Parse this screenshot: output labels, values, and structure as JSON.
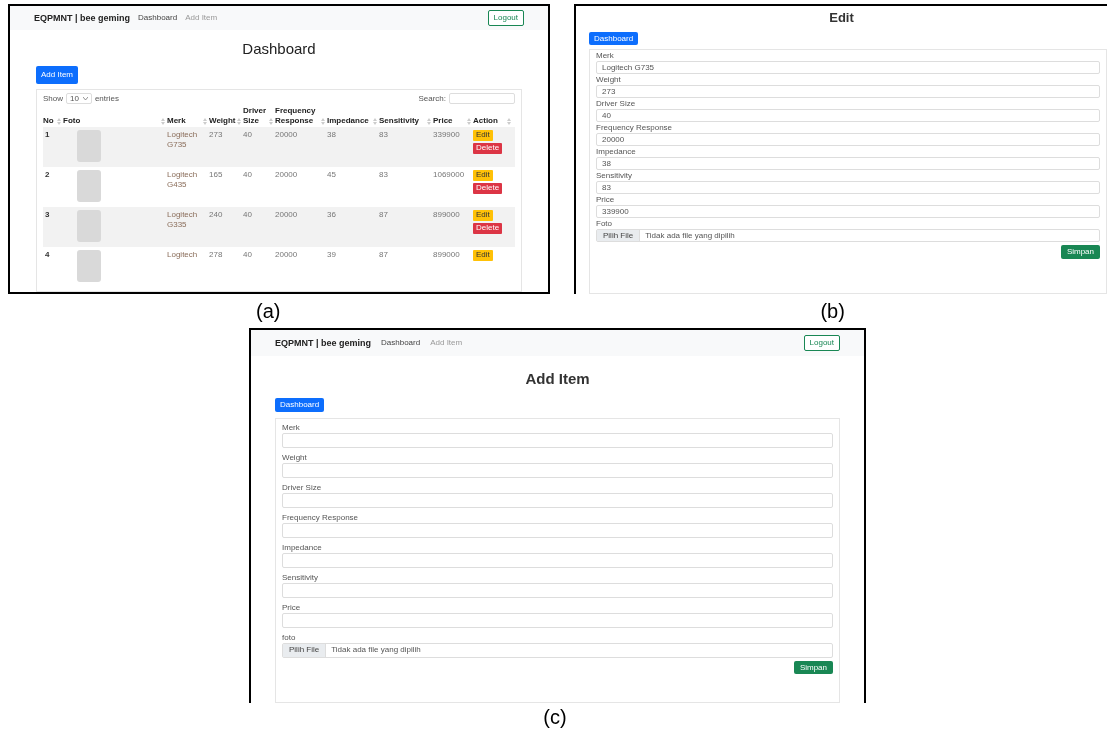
{
  "panels": [
    {
      "kind": "dashboard",
      "caption": "(a)",
      "navbar": {
        "brand": "EQPMNT | bee geming",
        "links": [
          {
            "label": "Dashboard",
            "selected": true
          },
          {
            "label": "Add Item",
            "selected": false
          }
        ],
        "logout": "Logout"
      },
      "title": "Dashboard",
      "add_button": "Add Item",
      "table": {
        "show_label": "Show",
        "page_size": "10",
        "entries_label": "entries",
        "search_label": "Search:",
        "columns": [
          "No",
          "Foto",
          "Merk",
          "Weight",
          "Driver Size",
          "Frequency Response",
          "Impedance",
          "Sensitivity",
          "Price",
          "Action"
        ],
        "rows": [
          {
            "no": "1",
            "merk": "Logitech G735",
            "weight": "273",
            "driver_size": "40",
            "frequency_response": "20000",
            "impedance": "38",
            "sensitivity": "83",
            "price": "339900",
            "actions": [
              "Edit",
              "Delete"
            ]
          },
          {
            "no": "2",
            "merk": "Logitech G435",
            "weight": "165",
            "driver_size": "40",
            "frequency_response": "20000",
            "impedance": "45",
            "sensitivity": "83",
            "price": "1069000",
            "actions": [
              "Edit",
              "Delete"
            ]
          },
          {
            "no": "3",
            "merk": "Logitech G335",
            "weight": "240",
            "driver_size": "40",
            "frequency_response": "20000",
            "impedance": "36",
            "sensitivity": "87",
            "price": "899000",
            "actions": [
              "Edit",
              "Delete"
            ]
          },
          {
            "no": "4",
            "merk": "Logitech",
            "weight": "278",
            "driver_size": "40",
            "frequency_response": "20000",
            "impedance": "39",
            "sensitivity": "87",
            "price": "899000",
            "actions": [
              "Edit"
            ]
          }
        ]
      }
    },
    {
      "kind": "form",
      "caption": "(b)",
      "title": "Edit",
      "back_button": "Dashboard",
      "fields": [
        {
          "label": "Merk",
          "value": "Logitech G735"
        },
        {
          "label": "Weight",
          "value": "273"
        },
        {
          "label": "Driver Size",
          "value": "40"
        },
        {
          "label": "Frequency Response",
          "value": "20000"
        },
        {
          "label": "Impedance",
          "value": "38"
        },
        {
          "label": "Sensitivity",
          "value": "83"
        },
        {
          "label": "Price",
          "value": "339900"
        }
      ],
      "file": {
        "label": "Foto",
        "button": "Pilih File",
        "status": "Tidak ada file yang dipilih"
      },
      "submit": "Simpan"
    },
    {
      "kind": "form",
      "caption": "(c)",
      "navbar": {
        "brand": "EQPMNT | bee geming",
        "links": [
          {
            "label": "Dashboard",
            "selected": true
          },
          {
            "label": "Add Item",
            "selected": false
          }
        ],
        "logout": "Logout"
      },
      "title": "Add Item",
      "back_button": "Dashboard",
      "fields": [
        {
          "label": "Merk"
        },
        {
          "label": "Weight"
        },
        {
          "label": "Driver Size"
        },
        {
          "label": "Frequency Response"
        },
        {
          "label": "Impedance"
        },
        {
          "label": "Sensitivity"
        },
        {
          "label": "Price"
        }
      ],
      "file": {
        "label": "foto",
        "button": "Pilih File",
        "status": "Tidak ada file yang dipilih"
      },
      "submit": "Simpan"
    }
  ]
}
